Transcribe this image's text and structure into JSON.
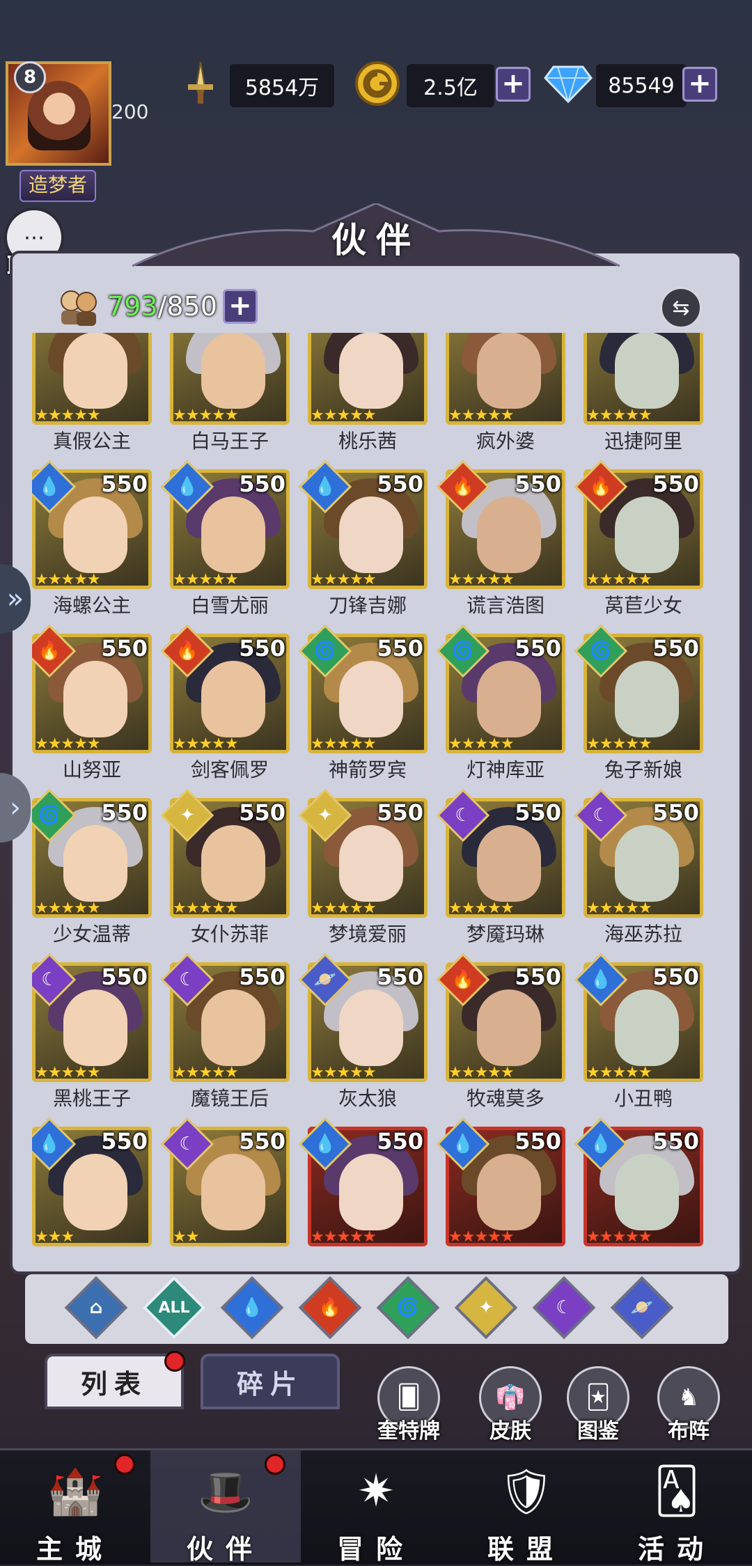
{
  "player": {
    "level": "8",
    "vip_value": "200",
    "title": "造梦者"
  },
  "resources": {
    "power": {
      "icon": "sword-icon",
      "value": "5854万"
    },
    "gold": {
      "icon": "gold-coin-icon",
      "value": "2.5亿"
    },
    "diamond": {
      "icon": "diamond-icon",
      "value": "85549"
    }
  },
  "chat": {
    "label": "聊天"
  },
  "panel": {
    "title": "伙伴",
    "count_current": "793",
    "count_sep": "/",
    "count_max": "850"
  },
  "heroes": [
    {
      "name": "真假公主",
      "level": "",
      "element": "",
      "stars": 5
    },
    {
      "name": "白马王子",
      "level": "",
      "element": "",
      "stars": 5
    },
    {
      "name": "桃乐茜",
      "level": "",
      "element": "",
      "stars": 5
    },
    {
      "name": "疯外婆",
      "level": "",
      "element": "",
      "stars": 5
    },
    {
      "name": "迅捷阿里",
      "level": "",
      "element": "",
      "stars": 5
    },
    {
      "name": "海螺公主",
      "level": "550",
      "element": "water",
      "stars": 5
    },
    {
      "name": "白雪尤丽",
      "level": "550",
      "element": "water",
      "stars": 5
    },
    {
      "name": "刀锋吉娜",
      "level": "550",
      "element": "water",
      "stars": 5
    },
    {
      "name": "谎言浩图",
      "level": "550",
      "element": "fire",
      "stars": 5
    },
    {
      "name": "莴苣少女",
      "level": "550",
      "element": "fire",
      "stars": 5
    },
    {
      "name": "山努亚",
      "level": "550",
      "element": "fire",
      "stars": 5
    },
    {
      "name": "剑客佩罗",
      "level": "550",
      "element": "fire",
      "stars": 5
    },
    {
      "name": "神箭罗宾",
      "level": "550",
      "element": "wind",
      "stars": 5
    },
    {
      "name": "灯神库亚",
      "level": "550",
      "element": "wind",
      "stars": 5
    },
    {
      "name": "兔子新娘",
      "level": "550",
      "element": "wind",
      "stars": 5
    },
    {
      "name": "少女温蒂",
      "level": "550",
      "element": "wind",
      "stars": 5
    },
    {
      "name": "女仆苏菲",
      "level": "550",
      "element": "light",
      "stars": 5
    },
    {
      "name": "梦境爱丽",
      "level": "550",
      "element": "light",
      "stars": 5
    },
    {
      "name": "梦魇玛琳",
      "level": "550",
      "element": "dark",
      "stars": 5
    },
    {
      "name": "海巫苏拉",
      "level": "550",
      "element": "dark",
      "stars": 5
    },
    {
      "name": "黑桃王子",
      "level": "550",
      "element": "dark",
      "stars": 5
    },
    {
      "name": "魔镜王后",
      "level": "550",
      "element": "dark",
      "stars": 5
    },
    {
      "name": "灰太狼",
      "level": "550",
      "element": "cosmic",
      "stars": 5
    },
    {
      "name": "牧魂莫多",
      "level": "550",
      "element": "fire",
      "stars": 5
    },
    {
      "name": "小丑鸭",
      "level": "550",
      "element": "water",
      "stars": 5
    },
    {
      "name": "",
      "level": "550",
      "element": "water",
      "stars": 3
    },
    {
      "name": "",
      "level": "550",
      "element": "dark",
      "stars": 2
    },
    {
      "name": "",
      "level": "550",
      "element": "water",
      "stars": 5,
      "red": true
    },
    {
      "name": "",
      "level": "550",
      "element": "water",
      "stars": 5,
      "red": true
    },
    {
      "name": "",
      "level": "550",
      "element": "water",
      "stars": 5,
      "red": true
    }
  ],
  "filters": [
    {
      "icon": "mountain-icon",
      "label": ""
    },
    {
      "icon": "all-icon",
      "label": "ALL"
    },
    {
      "icon": "water-drop-icon",
      "label": ""
    },
    {
      "icon": "fire-icon",
      "label": ""
    },
    {
      "icon": "wind-icon",
      "label": ""
    },
    {
      "icon": "light-icon",
      "label": ""
    },
    {
      "icon": "moon-icon",
      "label": ""
    },
    {
      "icon": "planet-icon",
      "label": ""
    }
  ],
  "tabs": {
    "list": "列表",
    "fragments": "碎片"
  },
  "side_buttons": [
    {
      "label": "奎特牌",
      "icon": "card-icon"
    },
    {
      "label": "皮肤",
      "icon": "skin-icon"
    },
    {
      "label": "图鉴",
      "icon": "codex-icon"
    },
    {
      "label": "布阵",
      "icon": "formation-icon"
    }
  ],
  "nav": [
    {
      "label": "主城",
      "icon": "castle-icon"
    },
    {
      "label": "伙伴",
      "icon": "witch-hat-icon"
    },
    {
      "label": "冒险",
      "icon": "compass-icon"
    },
    {
      "label": "联盟",
      "icon": "shield-icon"
    },
    {
      "label": "活动",
      "icon": "cards-icon"
    }
  ],
  "colors": {
    "accent_green": "#6fef58",
    "gold_frame": "#d9b43a",
    "red_frame": "#c7352a",
    "badge_red": "#e1262a"
  }
}
